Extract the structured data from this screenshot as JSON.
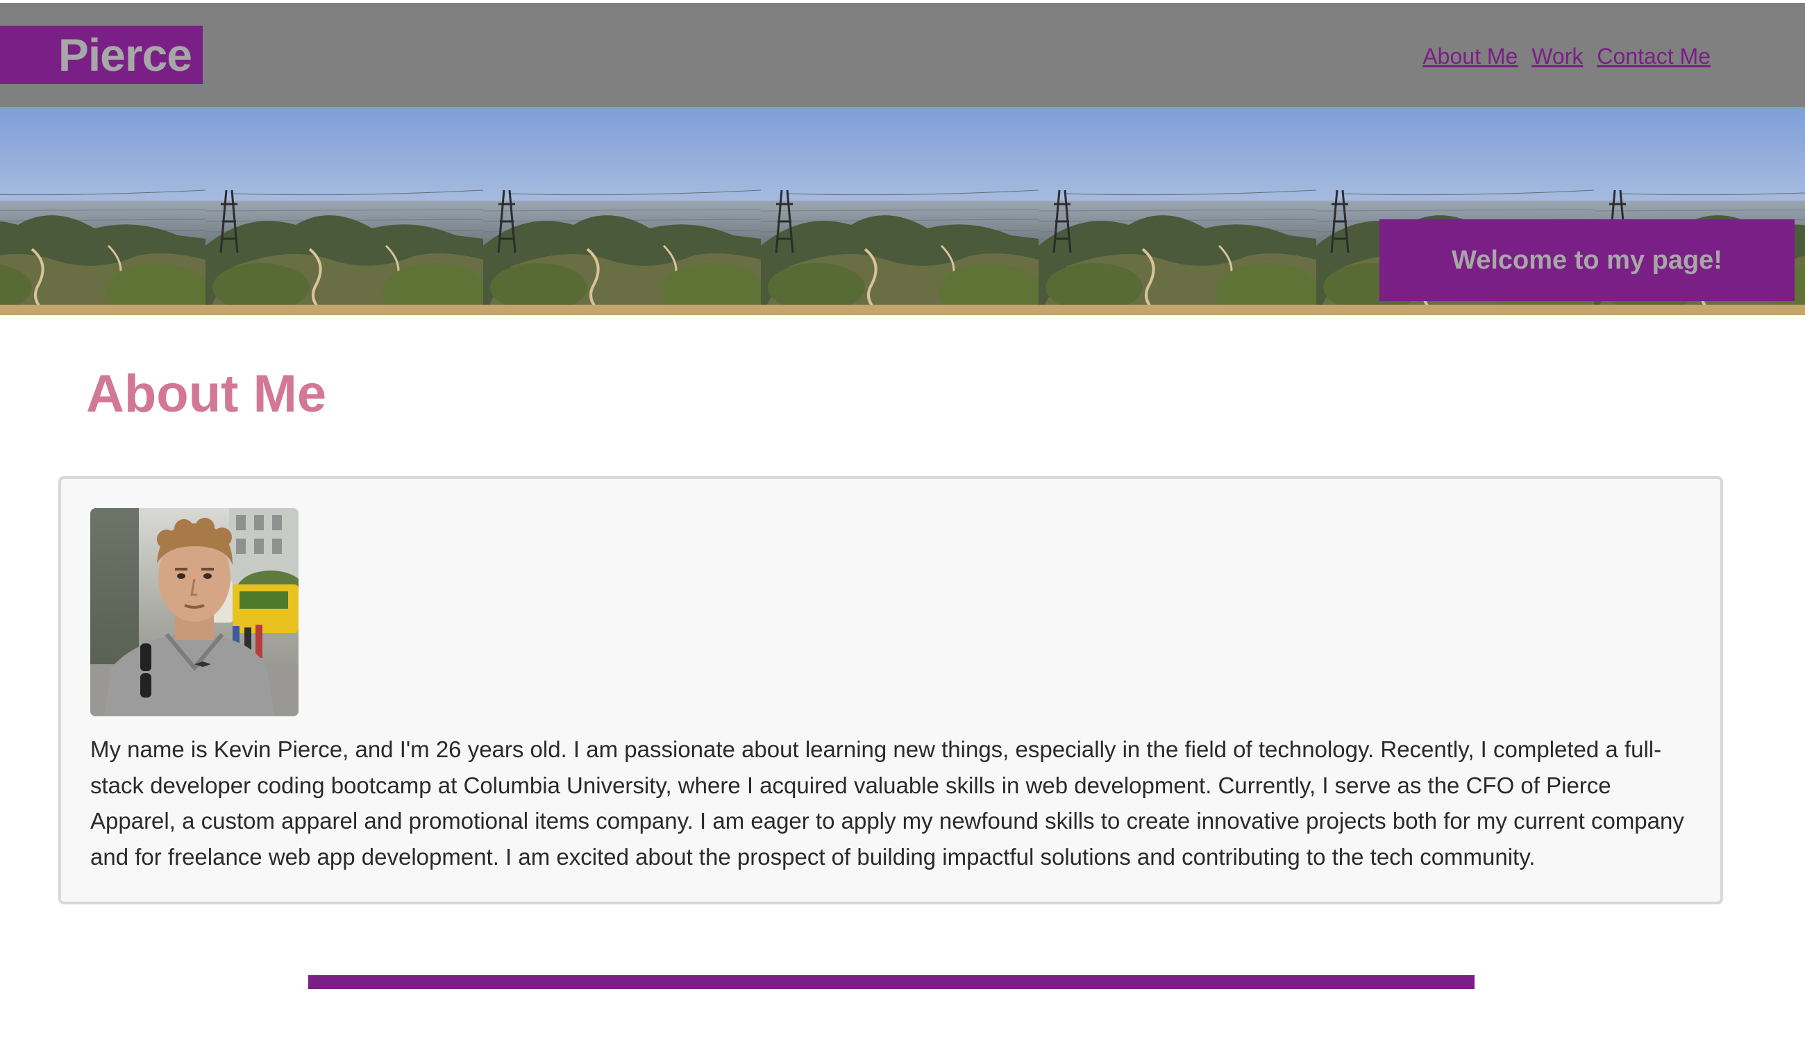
{
  "header": {
    "brand": "Pierce",
    "nav": [
      "About Me",
      "Work",
      "Contact Me"
    ]
  },
  "hero": {
    "tile_count": 7,
    "welcome": "Welcome to my page!"
  },
  "about": {
    "heading": "About Me",
    "bio": "My name is Kevin Pierce, and I'm 26 years old. I am passionate about learning new things, especially in the field of technology. Recently, I completed a full-stack developer coding bootcamp at Columbia University, where I acquired valuable skills in web development. Currently, I serve as the CFO of Pierce Apparel, a custom apparel and promotional items company. I am eager to apply my newfound skills to create innovative projects both for my current company and for freelance web app development. I am excited about the prospect of building impactful solutions and contributing to the tech community."
  },
  "colors": {
    "header_bg": "#808080",
    "brand_purple": "#7a1f86",
    "muted_text": "#a7a7a7",
    "heading_pink": "#d27896",
    "card_bg": "#f8f8f8"
  },
  "icons": [
    "landscape-photo",
    "profile-photo"
  ]
}
